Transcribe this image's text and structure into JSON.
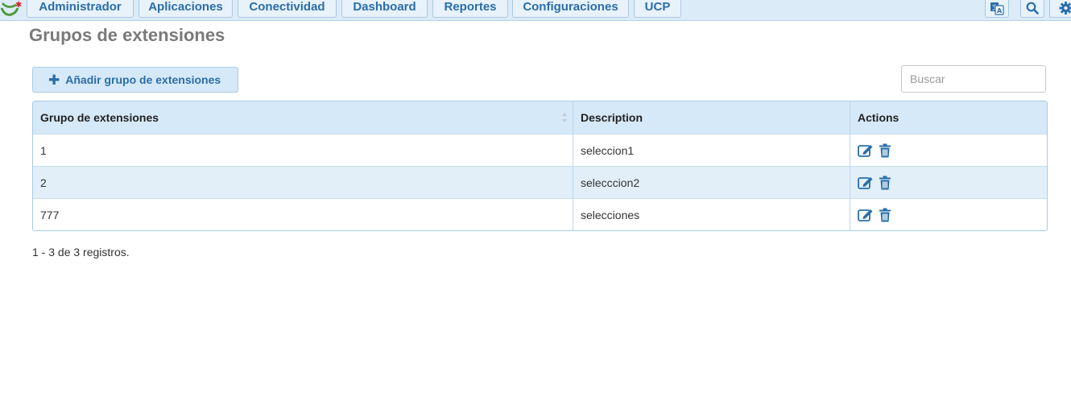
{
  "nav": {
    "items": [
      {
        "label": "Administrador"
      },
      {
        "label": "Aplicaciones"
      },
      {
        "label": "Conectividad"
      },
      {
        "label": "Dashboard"
      },
      {
        "label": "Reportes"
      },
      {
        "label": "Configuraciones"
      },
      {
        "label": "UCP"
      }
    ],
    "icons": [
      "translate-icon",
      "search-icon",
      "gear-icon"
    ]
  },
  "page": {
    "title": "Grupos de extensiones"
  },
  "toolbar": {
    "add_label": "Añadir grupo de extensiones",
    "search_placeholder": "Buscar"
  },
  "table": {
    "columns": [
      "Grupo de extensiones",
      "Description",
      "Actions"
    ],
    "rows": [
      {
        "group": "1",
        "description": "seleccion1"
      },
      {
        "group": "2",
        "description": "selecccion2"
      },
      {
        "group": "777",
        "description": "selecciones"
      }
    ]
  },
  "footer": {
    "info": "1 - 3 de 3 registros."
  },
  "colors": {
    "accent": "#2a6ea9",
    "header_bg": "#d6e9f8",
    "title_gray": "#7a7a7a"
  }
}
